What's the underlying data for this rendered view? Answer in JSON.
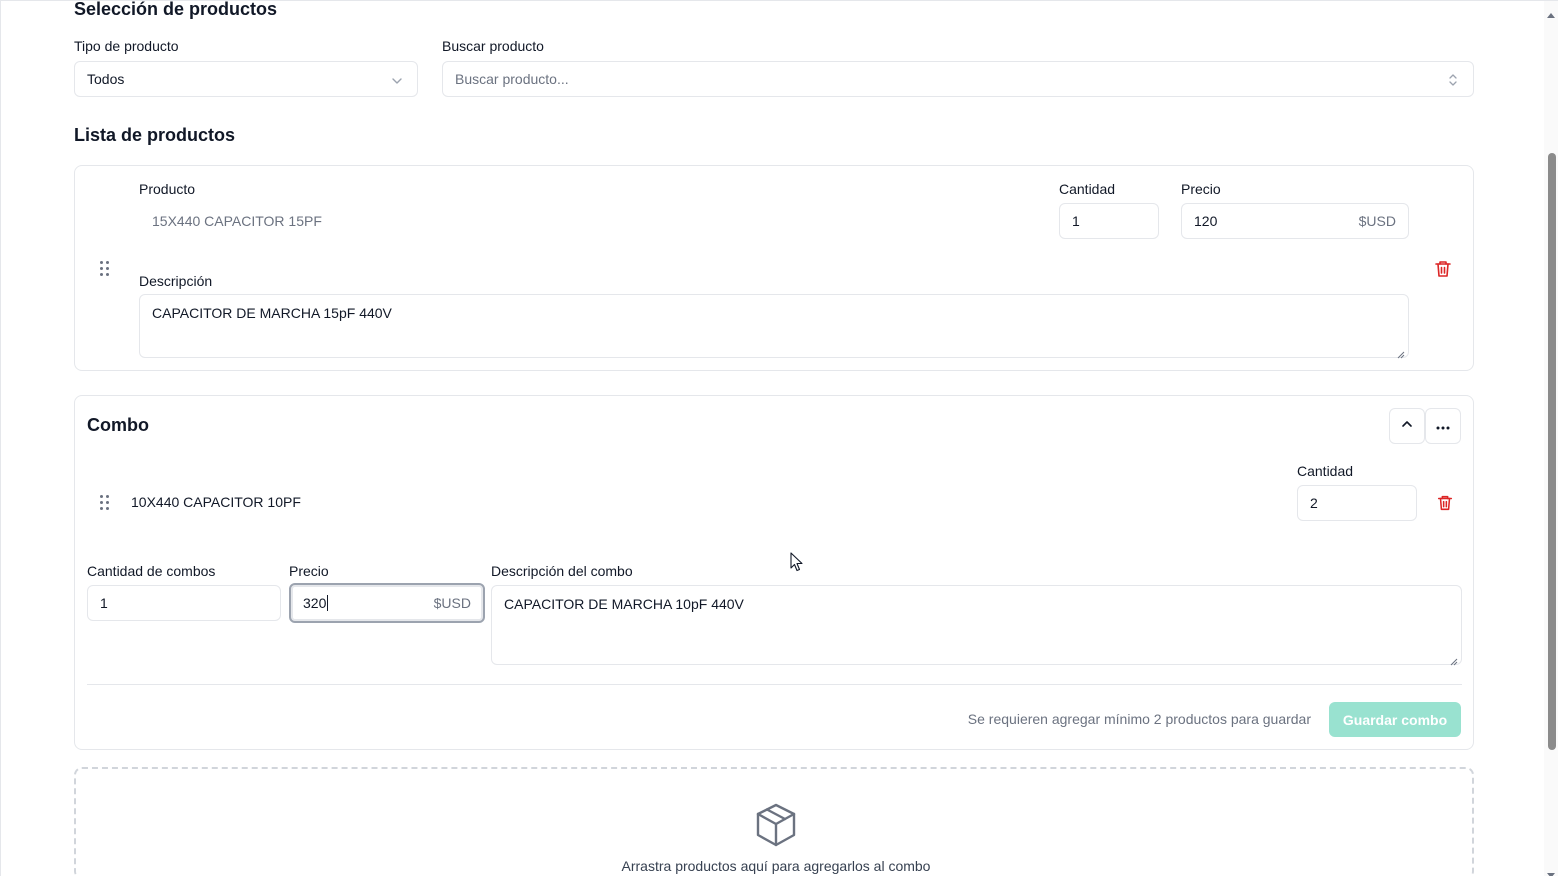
{
  "product_selection": {
    "title": "Selección de productos",
    "type_label": "Tipo de producto",
    "type_value": "Todos",
    "search_label": "Buscar producto",
    "search_placeholder": "Buscar producto..."
  },
  "product_list": {
    "title": "Lista de productos",
    "item": {
      "product_label": "Producto",
      "product_value": "15X440 CAPACITOR 15PF",
      "quantity_label": "Cantidad",
      "quantity_value": "1",
      "price_label": "Precio",
      "price_value": "120",
      "currency": "$USD",
      "description_label": "Descripción",
      "description_value": "CAPACITOR DE MARCHA 15pF 440V"
    }
  },
  "combo": {
    "title": "Combo",
    "item_name": "10X440 CAPACITOR 10PF",
    "item_quantity_label": "Cantidad",
    "item_quantity_value": "2",
    "combo_count_label": "Cantidad de combos",
    "combo_count_value": "1",
    "price_label": "Precio",
    "price_value": "320",
    "currency": "$USD",
    "description_label": "Descripción del combo",
    "description_value": "CAPACITOR DE MARCHA 10pF 440V",
    "requirement_message": "Se requieren agregar mínimo 2 productos para guardar",
    "save_button": "Guardar combo"
  },
  "dropzone": {
    "message": "Arrastra productos aquí para agregarlos al combo"
  },
  "colors": {
    "danger": "#dc2626",
    "save_button_disabled": "#99e2d0"
  },
  "icons": {
    "chevron": "chevron-down-icon",
    "sort": "chevron-up-down-icon",
    "grip": "drag-handle-icon",
    "trash": "trash-icon",
    "collapse": "chevron-up-icon",
    "more": "more-horizontal-icon",
    "box": "package-icon",
    "cursor": "mouse-pointer-icon"
  }
}
